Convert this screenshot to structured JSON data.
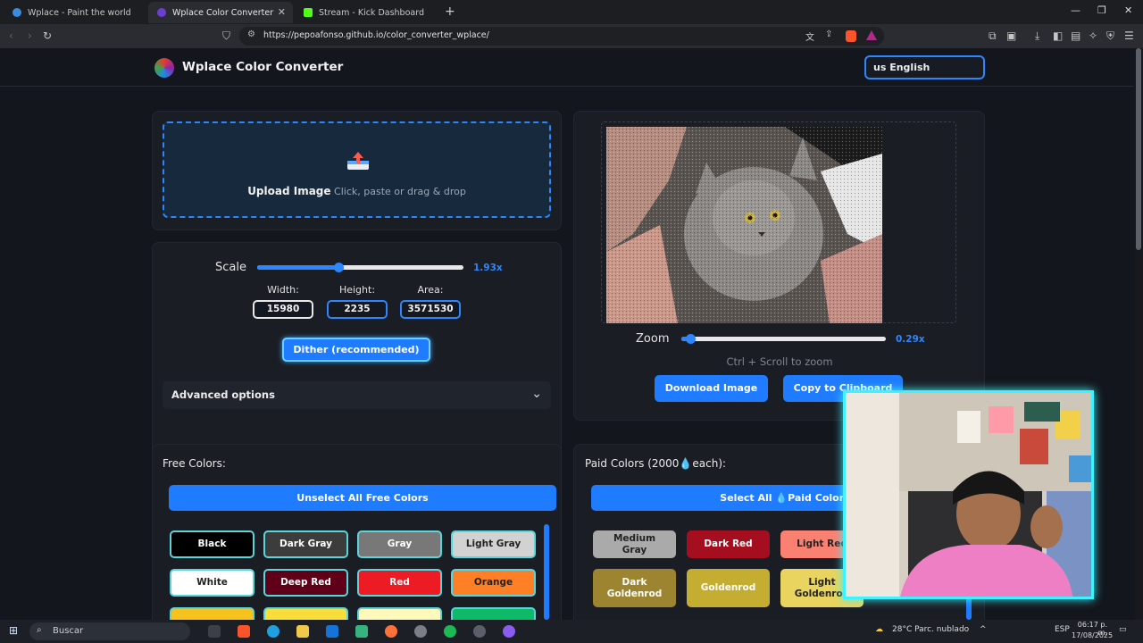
{
  "browser": {
    "tabs": [
      {
        "title": "Wplace - Paint the world",
        "active": false
      },
      {
        "title": "Wplace Color Converter",
        "active": true
      },
      {
        "title": "Stream - Kick Dashboard",
        "active": false
      }
    ],
    "url": "https://pepoafonso.github.io/color_converter_wplace/"
  },
  "header": {
    "brand": "Wplace Color Converter",
    "language": "us English"
  },
  "upload": {
    "title": "Upload Image",
    "hint": "Click, paste or drag & drop"
  },
  "scale": {
    "label": "Scale",
    "value": "1.93x",
    "level": 0.4
  },
  "dimensions": {
    "width_label": "Width:",
    "width_value": "15980",
    "height_label": "Height:",
    "height_value": "2235",
    "area_label": "Area:",
    "area_value": "3571530"
  },
  "dither_label": "Dither (recommended)",
  "advanced_label": "Advanced options",
  "zoom": {
    "label": "Zoom",
    "value": "0.29x",
    "level": 0.05,
    "hint": "Ctrl + Scroll to zoom"
  },
  "actions": {
    "download": "Download Image",
    "copy": "Copy to Clipboard"
  },
  "free_colors": {
    "title": "Free Colors:",
    "unselect_all": "Unselect All Free Colors",
    "items": [
      {
        "name": "Black",
        "bg": "#000000",
        "fg": "#ffffff"
      },
      {
        "name": "Dark Gray",
        "bg": "#3c3c3c",
        "fg": "#ffffff"
      },
      {
        "name": "Gray",
        "bg": "#787878",
        "fg": "#ffffff"
      },
      {
        "name": "Light Gray",
        "bg": "#d2d2d2",
        "fg": "#222222"
      },
      {
        "name": "White",
        "bg": "#ffffff",
        "fg": "#222222"
      },
      {
        "name": "Deep Red",
        "bg": "#600018",
        "fg": "#ffffff"
      },
      {
        "name": "Red",
        "bg": "#ed1c24",
        "fg": "#ffffff"
      },
      {
        "name": "Orange",
        "bg": "#ff7f27",
        "fg": "#222222"
      }
    ]
  },
  "paid_colors": {
    "title": "Paid Colors (2000💧each):",
    "select_all": "Select All 💧Paid Colors",
    "items": [
      {
        "name": "Medium Gray",
        "bg": "#aaaaaa",
        "fg": "#222222"
      },
      {
        "name": "Dark Red",
        "bg": "#a50e1e",
        "fg": "#ffffff"
      },
      {
        "name": "Light Red",
        "bg": "#fa8072",
        "fg": "#222222"
      },
      {
        "name": "Dark Goldenrod",
        "bg": "#9c8431",
        "fg": "#ffffff"
      },
      {
        "name": "Goldenrod",
        "bg": "#c5ad31",
        "fg": "#ffffff"
      },
      {
        "name": "Light Goldenrod",
        "bg": "#e8d45f",
        "fg": "#222222"
      }
    ]
  },
  "taskbar": {
    "search": "Buscar",
    "weather": "28°C Parc. nublado",
    "lang": "ESP",
    "time": "06:17 p. m.",
    "date": "17/08/2025"
  },
  "colors": {
    "accent": "#1f7bff",
    "page_bg": "#13161c",
    "card_bg": "#1a1d24",
    "webcam_border": "#3ef3ff"
  }
}
